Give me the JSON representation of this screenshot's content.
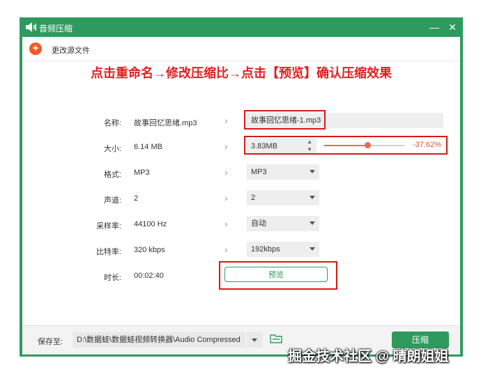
{
  "window": {
    "title": "音频压缩",
    "minimize": "—",
    "close": "✕"
  },
  "toolbar": {
    "add_icon_glyph": "+",
    "change_source_label": "更改源文件"
  },
  "instruction": "点击重命名→修改压缩比→点击【预览】确认压缩效果",
  "rows": {
    "name": {
      "label": "名称:",
      "original": "故事回忆思绪.mp3",
      "target": "故事回忆思绪-1.mp3"
    },
    "size": {
      "label": "大小:",
      "original": "6.14 MB",
      "target": "3.83MB",
      "ratio_text": "-37.62%",
      "slider_fraction": 0.54
    },
    "format": {
      "label": "格式:",
      "original": "MP3",
      "target": "MP3"
    },
    "channels": {
      "label": "声道:",
      "original": "2",
      "target": "2"
    },
    "samplerate": {
      "label": "采样率:",
      "original": "44100 Hz",
      "target": "自动"
    },
    "bitrate": {
      "label": "比特率:",
      "original": "320 kbps",
      "target": "192kbps"
    },
    "duration": {
      "label": "时长:",
      "original": "00:02:40"
    }
  },
  "preview_label": "预览",
  "footer": {
    "save_label": "保存至:",
    "path": "D:\\数据蛙\\数据蛙视频转换器\\Audio Compressed",
    "compress_label": "压缩"
  },
  "watermark": "掘金技术社区 @ 晴朗姐姐",
  "colors": {
    "frame": "#2f9a5e",
    "accent": "#e86a4a",
    "highlight": "#d81818",
    "add_button": "#f05a28"
  }
}
